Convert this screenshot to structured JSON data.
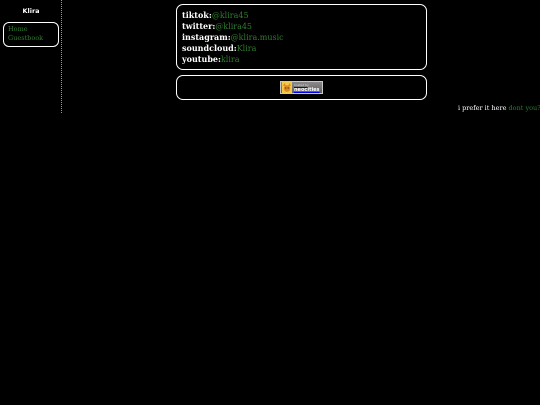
{
  "site": {
    "title": "Klira"
  },
  "nav": {
    "items": [
      {
        "label": "Home"
      },
      {
        "label": "Guestbook"
      }
    ]
  },
  "socials": [
    {
      "label": "tiktok:",
      "value": "@klira45"
    },
    {
      "label": "twitter:",
      "value": "@klira45"
    },
    {
      "label": "instagram:",
      "value": "@klira.music"
    },
    {
      "label": "soundcloud:",
      "value": "Klira"
    },
    {
      "label": "youtube:",
      "value": "klira"
    }
  ],
  "badge": {
    "line1": "hosted by",
    "line2": "neocities",
    "icon": "neocities-cat-icon"
  },
  "footer": {
    "main": "i prefer it here",
    "accent": "dont you?"
  },
  "colors": {
    "background": "#000000",
    "text": "#ffffff",
    "link": "#2e7d2e",
    "border": "#ffffff"
  }
}
